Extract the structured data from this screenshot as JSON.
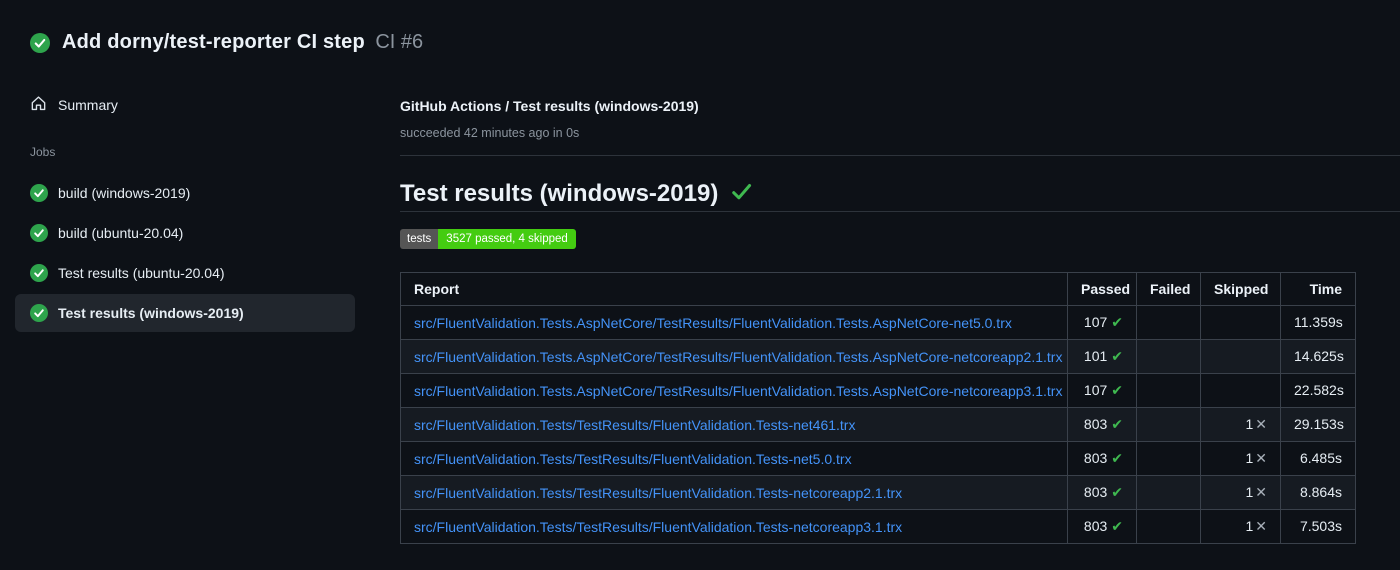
{
  "header": {
    "run_title": "Add dorny/test-reporter CI step",
    "run_number": "CI #6"
  },
  "sidebar": {
    "summary_label": "Summary",
    "jobs_label": "Jobs",
    "jobs": [
      {
        "label": "build (windows-2019)",
        "selected": false
      },
      {
        "label": "build (ubuntu-20.04)",
        "selected": false
      },
      {
        "label": "Test results (ubuntu-20.04)",
        "selected": false
      },
      {
        "label": "Test results (windows-2019)",
        "selected": true
      }
    ]
  },
  "main": {
    "breadcrumb": "GitHub Actions / Test results (windows-2019)",
    "status_line": "succeeded 42 minutes ago in 0s",
    "heading": "Test results (windows-2019)",
    "badge": {
      "label": "tests",
      "value": "3527 passed, 4 skipped"
    },
    "table": {
      "columns": [
        "Report",
        "Passed",
        "Failed",
        "Skipped",
        "Time"
      ],
      "rows": [
        {
          "report": "src/FluentValidation.Tests.AspNetCore/TestResults/FluentValidation.Tests.AspNetCore-net5.0.trx",
          "passed": "107",
          "failed": "",
          "skipped": "",
          "time": "11.359s"
        },
        {
          "report": "src/FluentValidation.Tests.AspNetCore/TestResults/FluentValidation.Tests.AspNetCore-netcoreapp2.1.trx",
          "passed": "101",
          "failed": "",
          "skipped": "",
          "time": "14.625s"
        },
        {
          "report": "src/FluentValidation.Tests.AspNetCore/TestResults/FluentValidation.Tests.AspNetCore-netcoreapp3.1.trx",
          "passed": "107",
          "failed": "",
          "skipped": "",
          "time": "22.582s"
        },
        {
          "report": "src/FluentValidation.Tests/TestResults/FluentValidation.Tests-net461.trx",
          "passed": "803",
          "failed": "",
          "skipped": "1",
          "time": "29.153s"
        },
        {
          "report": "src/FluentValidation.Tests/TestResults/FluentValidation.Tests-net5.0.trx",
          "passed": "803",
          "failed": "",
          "skipped": "1",
          "time": "6.485s"
        },
        {
          "report": "src/FluentValidation.Tests/TestResults/FluentValidation.Tests-netcoreapp2.1.trx",
          "passed": "803",
          "failed": "",
          "skipped": "1",
          "time": "8.864s"
        },
        {
          "report": "src/FluentValidation.Tests/TestResults/FluentValidation.Tests-netcoreapp3.1.trx",
          "passed": "803",
          "failed": "",
          "skipped": "1",
          "time": "7.503s"
        }
      ]
    }
  },
  "icons": {
    "passed_glyph": "✔",
    "skipped_glyph": "✕"
  },
  "colors": {
    "page_bg": "#0d1117",
    "row_alt_bg": "#161b22",
    "selected_item_bg": "#21262d",
    "border": "#3a414b",
    "success_green": "#3fb950",
    "circle_green": "#2ea44c",
    "link_blue": "#4493f8",
    "badge_label_bg": "#555555",
    "badge_value_bg": "#44cc11",
    "muted_text": "#8b949e"
  }
}
